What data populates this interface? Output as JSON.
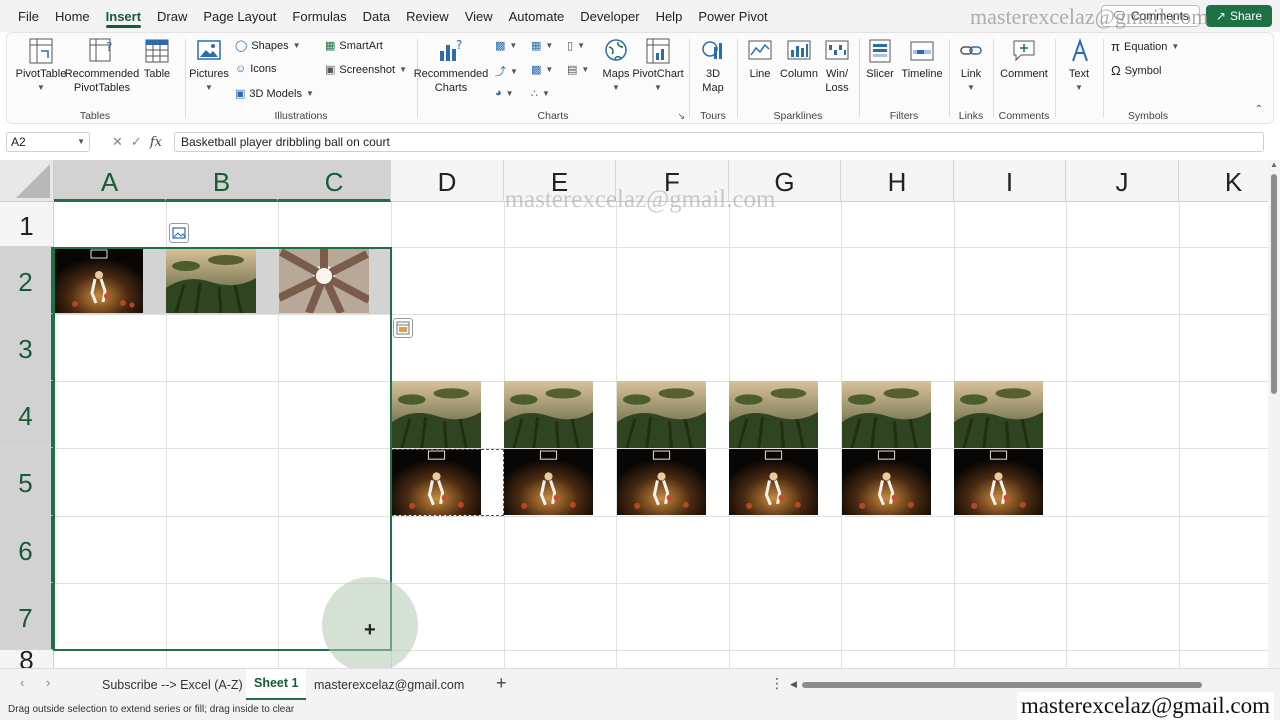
{
  "menu": {
    "tabs": [
      "File",
      "Home",
      "Insert",
      "Draw",
      "Page Layout",
      "Formulas",
      "Data",
      "Review",
      "View",
      "Automate",
      "Developer",
      "Help",
      "Power Pivot"
    ],
    "active_index": 2,
    "comments_label": "Comments",
    "share_label": "Share"
  },
  "ribbon": {
    "tables": {
      "label": "Tables",
      "pivottable": "PivotTable",
      "recommended_1": "Recommended",
      "recommended_2": "PivotTables",
      "table": "Table"
    },
    "illustrations": {
      "label": "Illustrations",
      "pictures": "Pictures",
      "shapes": "Shapes",
      "icons": "Icons",
      "models": "3D Models",
      "smartart": "SmartArt",
      "screenshot": "Screenshot"
    },
    "charts": {
      "label": "Charts",
      "recommended_1": "Recommended",
      "recommended_2": "Charts",
      "maps": "Maps",
      "pivotchart": "PivotChart"
    },
    "tours": {
      "label": "Tours",
      "map_1": "3D",
      "map_2": "Map"
    },
    "sparklines": {
      "label": "Sparklines",
      "line": "Line",
      "column": "Column",
      "winloss_1": "Win/",
      "winloss_2": "Loss"
    },
    "filters": {
      "label": "Filters",
      "slicer": "Slicer",
      "timeline": "Timeline"
    },
    "links": {
      "label": "Links",
      "link": "Link"
    },
    "comments": {
      "label": "Comments",
      "comment": "Comment"
    },
    "text": {
      "text": "Text"
    },
    "symbols": {
      "label": "Symbols",
      "equation": "Equation",
      "symbol": "Symbol"
    }
  },
  "formula_bar": {
    "name_box": "A2",
    "fx": "fx",
    "content": "Basketball player dribbling ball on court"
  },
  "grid": {
    "columns": [
      "A",
      "B",
      "C",
      "D",
      "E",
      "F",
      "G",
      "H",
      "I",
      "J",
      "K"
    ],
    "rows": [
      "1",
      "2",
      "3",
      "4",
      "5",
      "6",
      "7",
      "8"
    ]
  },
  "watermarks": {
    "email": "masterexcelaz@gmail.com"
  },
  "sheets": {
    "tabs": [
      "Subscribe --> Excel (A-Z)",
      "Sheet 1",
      "masterexcelaz@gmail.com"
    ],
    "active_index": 1
  },
  "status": {
    "message": "Drag outside selection to extend series or fill; drag inside to clear"
  },
  "colors": {
    "accent": "#1e7145",
    "accent_text": "#185c37"
  }
}
